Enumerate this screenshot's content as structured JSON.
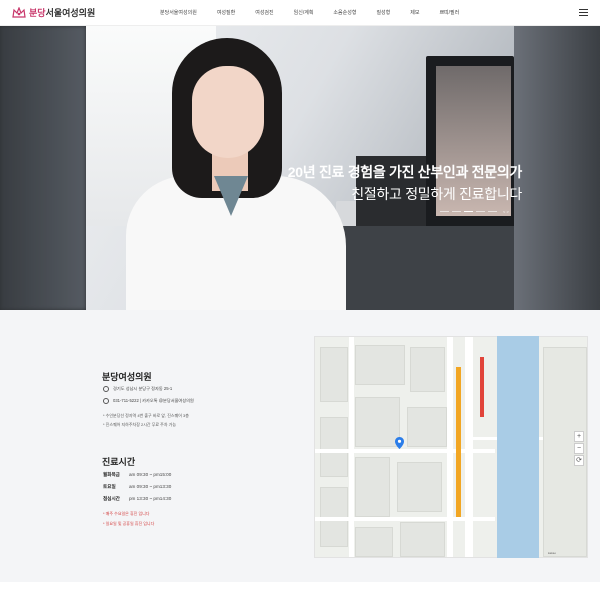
{
  "header": {
    "logo_brand": "분당",
    "logo_name": "서울여성의원",
    "nav": [
      "분당서울여성의원",
      "여성질환",
      "여성검진",
      "임신/계획",
      "소음순성형",
      "질성형",
      "제모",
      "쁘띠/필러"
    ],
    "menu_icon": "hamburger-icon"
  },
  "hero": {
    "title": "20년 진료 경험을 가진 산부인과 전문의가",
    "subtitle": "친절하고 정밀하게 진료합니다",
    "slide_controls": "< >",
    "slide_count": 5,
    "active_slide": 3
  },
  "info": {
    "clinic_name": "분당여성의원",
    "address": "경기도 성남시 분당구 정자동 25-1",
    "phone": "031-711-5222  |  카카오톡 @분당서울여성의원",
    "notes": [
      "수인분당선 정자역 4번 출구 바로 앞, 진스퀘어 3층",
      "진스퀘어 지하주차장 2시간 무료 주차 가능"
    ],
    "hours_title": "진료시간",
    "hours": [
      {
        "day": "월화목금",
        "time": "am 09:30 ~ pm15:00"
      },
      {
        "day": "토요일",
        "time": "am 09:30 ~ pm13:30"
      },
      {
        "day": "점심시간",
        "time": "pm 13:30 ~ pm14:30"
      }
    ],
    "red_notes": [
      "* 매주 수요일은 휴진 입니다",
      "* 일요일 및 공휴일 휴진 입니다"
    ]
  },
  "map": {
    "zoom_in": "+",
    "zoom_out": "−",
    "reset": "⟳",
    "credit": "kakao"
  },
  "colors": {
    "brand": "#c8366a",
    "accent_red": "#d23b3b",
    "river": "#a9cce6",
    "rail_line": "#f2a623"
  }
}
